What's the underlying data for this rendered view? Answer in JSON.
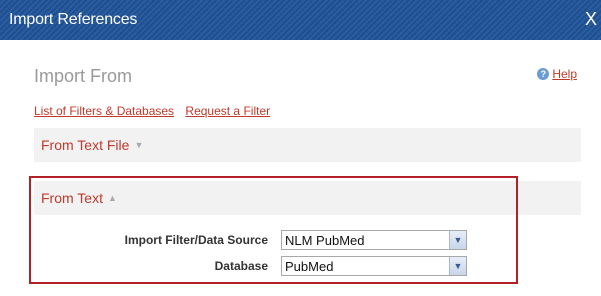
{
  "window": {
    "title": "Import References",
    "close_label": "X"
  },
  "section": {
    "title": "Import From"
  },
  "help": {
    "label": "Help",
    "icon": "help-icon"
  },
  "links": {
    "filters_databases": "List of Filters & Databases",
    "request_filter": "Request a Filter"
  },
  "panels": {
    "from_text_file": {
      "label": "From Text File",
      "arrow": "▼",
      "expanded": false
    },
    "from_text": {
      "label": "From Text",
      "arrow": "▲",
      "expanded": true
    }
  },
  "form": {
    "import_filter": {
      "label": "Import Filter/Data Source",
      "value": "NLM PubMed"
    },
    "database": {
      "label": "Database",
      "value": "PubMed"
    }
  },
  "colors": {
    "title_bar": "#2a5d9f",
    "link": "#c0392b",
    "highlight_border": "#b32025"
  }
}
